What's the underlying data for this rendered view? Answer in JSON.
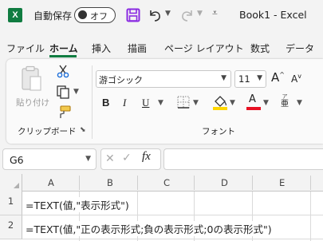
{
  "app": {
    "logo_letter": "X",
    "autosave_label": "自動保存",
    "autosave_state": "オフ",
    "document_title": "Book1  -  Excel"
  },
  "menu": {
    "tabs": [
      "ファイル",
      "ホーム",
      "挿入",
      "描画",
      "ページ レイアウト",
      "数式",
      "データ"
    ],
    "active_tab": "ホーム"
  },
  "ribbon": {
    "clipboard": {
      "paste_label": "貼り付け",
      "group_label": "クリップボード"
    },
    "font": {
      "font_name": "游ゴシック",
      "font_size": "11",
      "grow_label": "A",
      "shrink_label": "A",
      "bold": "B",
      "italic": "I",
      "underline": "U",
      "font_color_letter": "A",
      "phonetic_glyph": "亜",
      "group_label": "フォント"
    }
  },
  "formula_bar": {
    "name_box": "G6",
    "dots": "⋮",
    "cancel": "✕",
    "enter": "✓",
    "fx": "fx",
    "formula": ""
  },
  "grid": {
    "columns": [
      "A",
      "B",
      "C",
      "D",
      "E"
    ],
    "rows": [
      {
        "row": "1",
        "A": "=TEXT(値,\"表示形式\")"
      },
      {
        "row": "2",
        "A": "=TEXT(値,\"正の表示形式;負の表示形式;0の表示形式\")"
      }
    ]
  },
  "colors": {
    "excel_green": "#107c41",
    "save_purple": "#8a2be2",
    "fill_yellow": "#ffd700",
    "font_red": "#e81123"
  }
}
